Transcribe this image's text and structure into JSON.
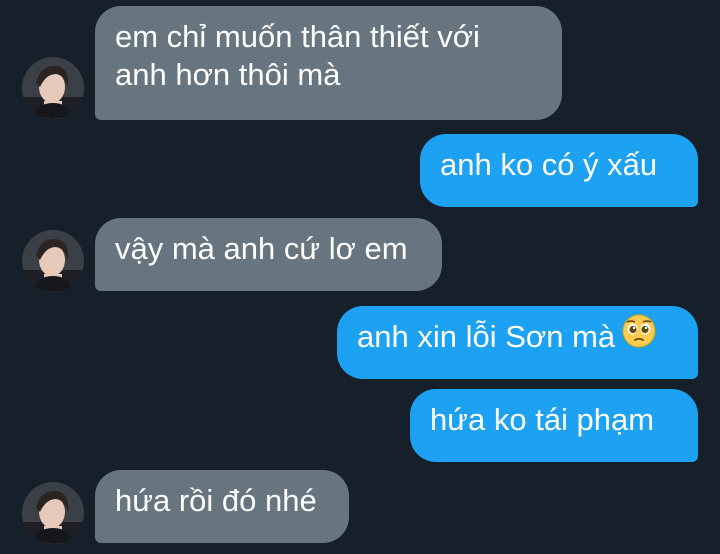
{
  "messages": [
    {
      "side": "received",
      "lines": [
        "em chỉ muốn thân thiết với",
        "anh hơn thôi mà"
      ]
    },
    {
      "side": "sent",
      "text": "anh ko có ý xấu"
    },
    {
      "side": "received",
      "text": "vậy mà anh cứ lơ em"
    },
    {
      "side": "sent",
      "text": "anh xin lỗi Sơn mà",
      "emoji": "pleading-face-icon"
    },
    {
      "side": "sent",
      "text": "hứa ko tái phạm"
    },
    {
      "side": "received",
      "text": "hứa rồi đó nhé"
    }
  ],
  "colors": {
    "background": "#15202b",
    "received_bubble": "#66757f",
    "sent_bubble": "#1da1f2",
    "text": "#ffffff"
  }
}
